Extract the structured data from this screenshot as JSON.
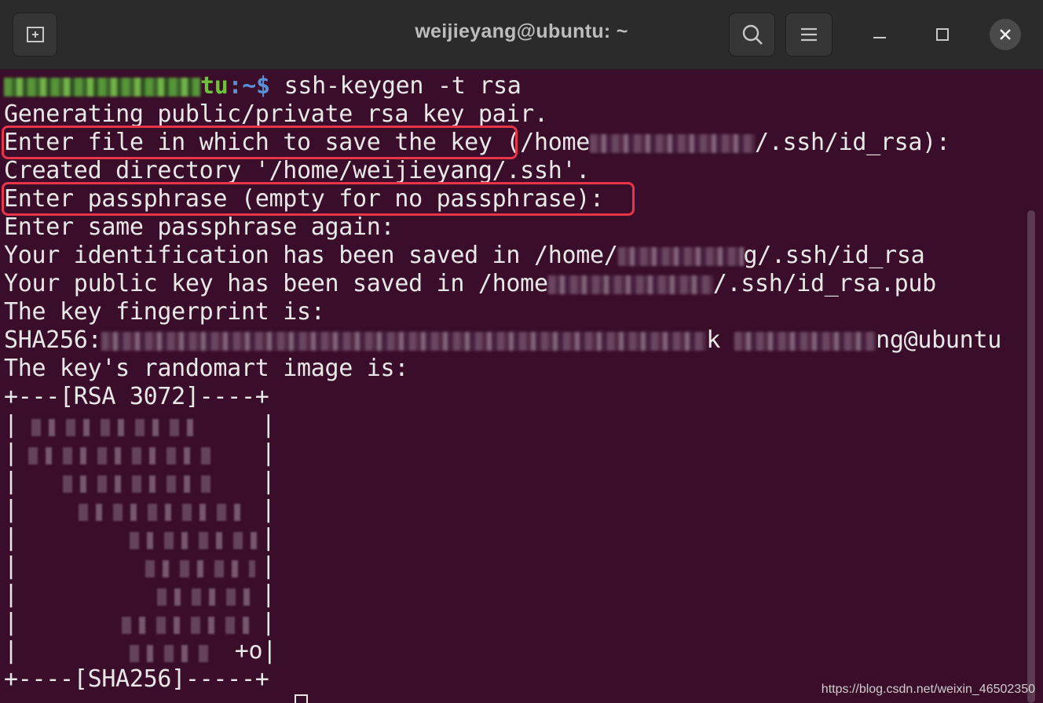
{
  "window": {
    "title": "weijieyang@ubuntu: ~",
    "icons": {
      "new_tab": "new-tab-icon",
      "search": "search-icon",
      "menu": "hamburger-menu-icon",
      "minimize": "minimize-icon",
      "maximize": "maximize-icon",
      "close": "close-icon"
    }
  },
  "terminal": {
    "prompt_suffix": ":~$ ",
    "prompt_user_visible": "tu",
    "command": "ssh-keygen -t rsa",
    "lines": {
      "l1": "Generating public/private rsa key pair.",
      "l2a": "Enter file in which to save the key ",
      "l2b": "(/home",
      "l2c": "/.ssh/id_rsa):",
      "l3": "Created directory '/home/weijieyang/.ssh'.",
      "l4": "Enter passphrase (empty for no passphrase):",
      "l5": "Enter same passphrase again:",
      "l6a": "Your identification has been saved in /home/",
      "l6b": "g/.ssh/id_rsa",
      "l7a": "Your public key has been saved in /home",
      "l7b": "/.ssh/id_rsa.pub",
      "l8": "The key fingerprint is:",
      "l9a": "SHA256:",
      "l9b": "k",
      "l9c": "ng@ubuntu",
      "l10": "The key's randomart image is:",
      "art_top": "+---[RSA 3072]----+",
      "art_bottom": "+----[SHA256]-----+",
      "art_row_9": "+o",
      "bar": "|"
    },
    "colors": {
      "background": "#3a0d2a",
      "text": "#e8e8e8",
      "prompt_user": "#6ec33a",
      "prompt_path": "#5b8fd6",
      "highlight_box": "#e8354a"
    }
  },
  "watermark": "https://blog.csdn.net/weixin_46502350"
}
